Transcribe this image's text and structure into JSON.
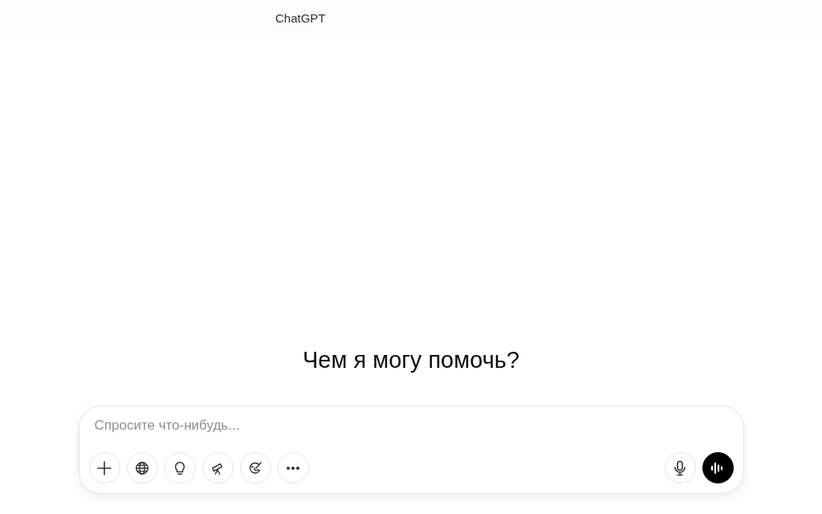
{
  "header": {
    "title": "ChatGPT"
  },
  "heading": "Чем я могу помочь?",
  "composer": {
    "placeholder": "Спросите что-нибудь...",
    "tools": [
      {
        "kind": "add"
      },
      {
        "kind": "web"
      },
      {
        "kind": "idea"
      },
      {
        "kind": "telescope"
      },
      {
        "kind": "paint"
      },
      {
        "kind": "more"
      }
    ],
    "actions": [
      {
        "kind": "mic"
      },
      {
        "kind": "voice"
      }
    ]
  }
}
